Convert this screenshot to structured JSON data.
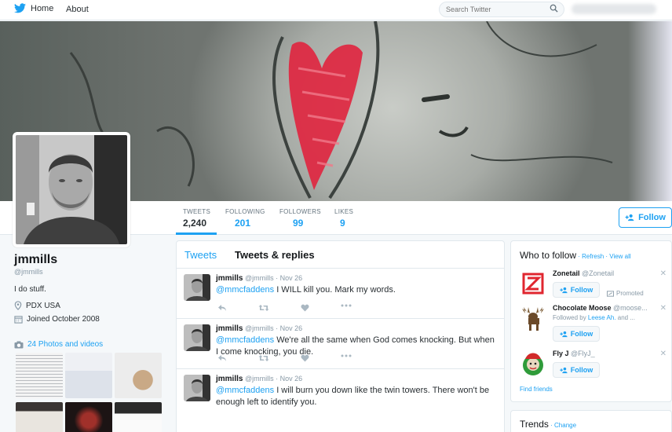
{
  "nav": {
    "home_label": "Home",
    "about_label": "About",
    "search_placeholder": "Search Twitter",
    "brand_color": "#1da1f2"
  },
  "profile": {
    "name": "jmmills",
    "handle": "@jmmills",
    "bio": "I do stuff.",
    "location": "PDX USA",
    "joined": "Joined October 2008",
    "photos_link": "24 Photos and videos",
    "follow_label": "Follow"
  },
  "stats": [
    {
      "label": "TWEETS",
      "value": "2,240"
    },
    {
      "label": "FOLLOWING",
      "value": "201"
    },
    {
      "label": "FOLLOWERS",
      "value": "99"
    },
    {
      "label": "LIKES",
      "value": "9"
    }
  ],
  "timeline": {
    "tabs": [
      "Tweets",
      "Tweets & replies"
    ],
    "tweets": [
      {
        "name": "jmmills",
        "handle": "@jmmills",
        "date": "· Nov 26",
        "mention": "@mmcfaddens",
        "text": " I WILL kill you. Mark my words."
      },
      {
        "name": "jmmills",
        "handle": "@jmmills",
        "date": "· Nov 26",
        "mention": "@mmcfaddens",
        "text": " We're all the same when God comes knocking. But when I come knocking, you die."
      },
      {
        "name": "jmmills",
        "handle": "@jmmills",
        "date": "· Nov 26",
        "mention": "@mmcfaddens",
        "text": " I will burn you down like the twin towers. There won't be enough left to identify you."
      }
    ]
  },
  "who_to_follow": {
    "title": "Who to follow",
    "refresh": "Refresh",
    "view_all": "View all",
    "sep": " · ",
    "suggestions": [
      {
        "name": "Zonetail",
        "handle": "@Zonetail",
        "follow": "Follow",
        "promoted": "Promoted"
      },
      {
        "name": "Chocolate Moose",
        "handle": "@moose...",
        "followed_by_prefix": "Followed by ",
        "followed_by_name": "Leese Ah.",
        "followed_by_suffix": " and ...",
        "follow": "Follow"
      },
      {
        "name": "Fly J",
        "handle": "@FlyJ_",
        "follow": "Follow"
      }
    ],
    "find_friends": "Find friends"
  },
  "trends": {
    "title": "Trends",
    "change": "Change",
    "sep": " · "
  }
}
